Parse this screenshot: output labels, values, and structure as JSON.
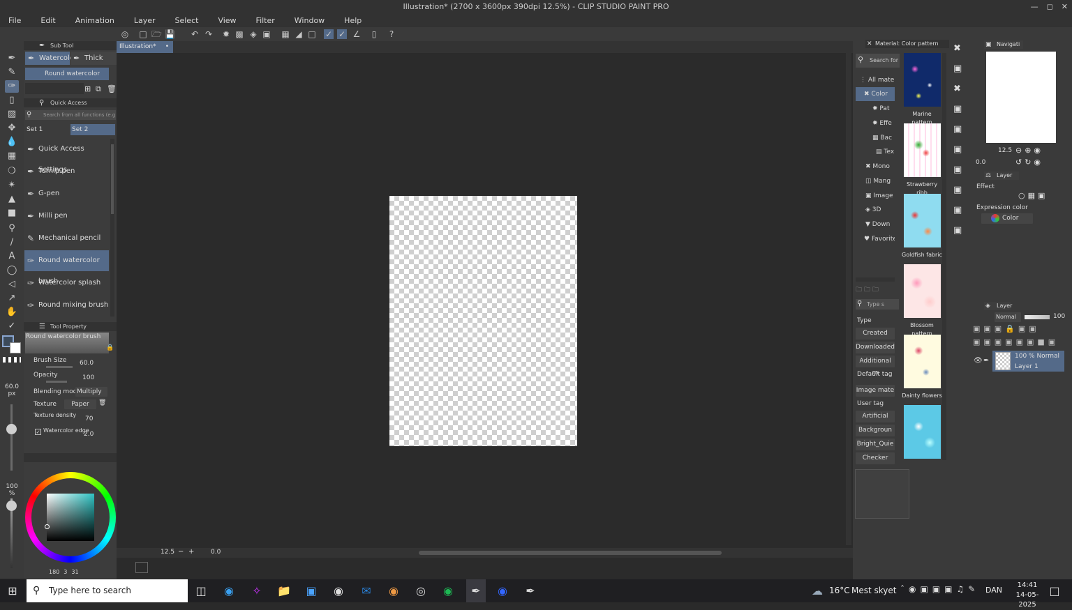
{
  "window": {
    "title": "Illustration* (2700 x 3600px 390dpi 12.5%) - CLIP STUDIO PAINT PRO"
  },
  "menu": [
    "File",
    "Edit",
    "Animation",
    "Layer",
    "Select",
    "View",
    "Filter",
    "Window",
    "Help"
  ],
  "subtool": {
    "header": "Sub Tool",
    "tabs": [
      "Watercolor",
      "Thick paint"
    ],
    "selected_brush": "Round watercolor brush"
  },
  "quick_access": {
    "header": "Quick Access",
    "search_placeholder": "Search from all functions (e.g. C",
    "sets": [
      "Set 1",
      "Set 2"
    ],
    "items": [
      "Quick Access Settings",
      "Turnip pen",
      "G-pen",
      "Milli pen",
      "Mechanical pencil",
      "Round watercolor brush",
      "Watercolor splash",
      "Round mixing brush"
    ]
  },
  "tool_property": {
    "header": "Tool Property",
    "brush_name": "Round watercolor brush",
    "brush_size_label": "Brush Size",
    "brush_size": "60.0",
    "opacity_label": "Opacity",
    "opacity": "100",
    "blending_label": "Blending mode",
    "blending": "Multiply",
    "texture_label": "Texture",
    "texture": "Paper",
    "texture_density_label": "Texture density",
    "texture_density": "70",
    "watercolor_edge_label": "Watercolor edge",
    "watercolor_edge": "2.0"
  },
  "brush_size_indicator": {
    "value": "60.0",
    "unit": "px"
  },
  "opacity_indicator": {
    "value": "100",
    "unit": "%"
  },
  "color_panel": {
    "rgb_readout": "180",
    "g": "3",
    "b": "31"
  },
  "canvas": {
    "tab_label": "Illustration*",
    "zoom": "12.5",
    "angle": "0.0"
  },
  "material_panel": {
    "header": "Material: Color pattern",
    "search_label": "Search for ma",
    "tree": [
      "All mate",
      "Color",
      "Pat",
      "Effe",
      "Bac",
      "Tex",
      "Mono",
      "Mang",
      "Image",
      "3D",
      "Down",
      "Favorite"
    ],
    "thumbnails": [
      "Marine pattern",
      "Strawberry ribb",
      "Goldfish fabric",
      "Blossom pattern",
      "Dainty flowers"
    ],
    "search_type_placeholder": "Type s",
    "filters": {
      "type_label": "Type",
      "type_items": [
        "Created mat",
        "Downloaded",
        "Additional m"
      ],
      "default_tag_label": "Default tag",
      "default_tag_items": [
        "Image mate"
      ],
      "user_tag_label": "User tag",
      "user_tag_items": [
        "Artificial",
        "Backgroun",
        "Bright_Quie",
        "Checker"
      ]
    }
  },
  "navigator": {
    "header": "Navigati",
    "zoom": "12.5",
    "angle": "0.0"
  },
  "layer_property": {
    "header": "Layer Pr",
    "effect_label": "Effect",
    "expression_label": "Expression color",
    "expression_value": "Color"
  },
  "layer_panel": {
    "header": "Layer",
    "blend_mode": "Normal",
    "opacity": "100",
    "layer": {
      "mode": "100 % Normal",
      "name": "Layer 1"
    }
  },
  "taskbar": {
    "search_placeholder": "Type here to search",
    "weather_temp": "16°C",
    "weather_desc": "Mest skyet",
    "language": "DAN",
    "time": "14:41",
    "date": "14-05-2025"
  }
}
